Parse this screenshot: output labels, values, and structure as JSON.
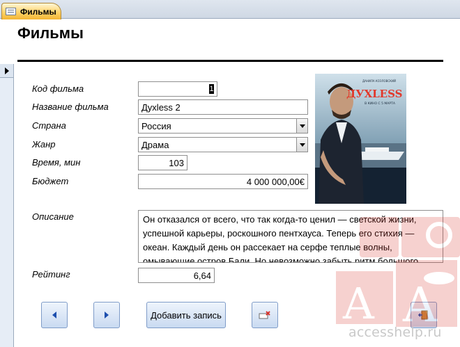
{
  "tab": {
    "label": "Фильмы",
    "icon": "form-icon"
  },
  "form": {
    "title": "Фильмы",
    "fields": {
      "code": {
        "label": "Код фильма",
        "value": "1"
      },
      "name": {
        "label": "Название фильма",
        "value": "Дyxless 2"
      },
      "country": {
        "label": "Страна",
        "value": "Россия"
      },
      "genre": {
        "label": "Жанр",
        "value": "Драма"
      },
      "duration": {
        "label": "Время, мин",
        "value": "103"
      },
      "budget": {
        "label": "Бюджет",
        "value": "4 000 000,00€"
      },
      "description": {
        "label": "Описание",
        "value": "Он отказался от всего, что так когда-то ценил — светской жизни, успешной карьеры, роскошного пентхауса. Теперь его стихия — океан. Каждый день он рассекает на серфе теплые волны, омывающие остров Бали. Но невозможно забыть ритм большого"
      },
      "rating": {
        "label": "Рейтинг",
        "value": "6,64"
      }
    },
    "poster": {
      "actor": "ДАНИЛА КОЗЛОВСКИЙ",
      "title": "ДУХLESS 2",
      "subtitle": "В КИНО С 5 МАРТА"
    },
    "buttons": {
      "prev": "previous-record",
      "next": "next-record",
      "add_label": "Добавить запись",
      "delete": "delete-record",
      "exit": "close-form"
    }
  },
  "watermark": {
    "text": "accesshelp.ru"
  },
  "colors": {
    "tab_active": "#ffd36a",
    "tabstrip": "#dfe6ef",
    "button": "#c9daf1",
    "button_border": "#7f9cc8",
    "watermark_red": "#d9342b"
  }
}
